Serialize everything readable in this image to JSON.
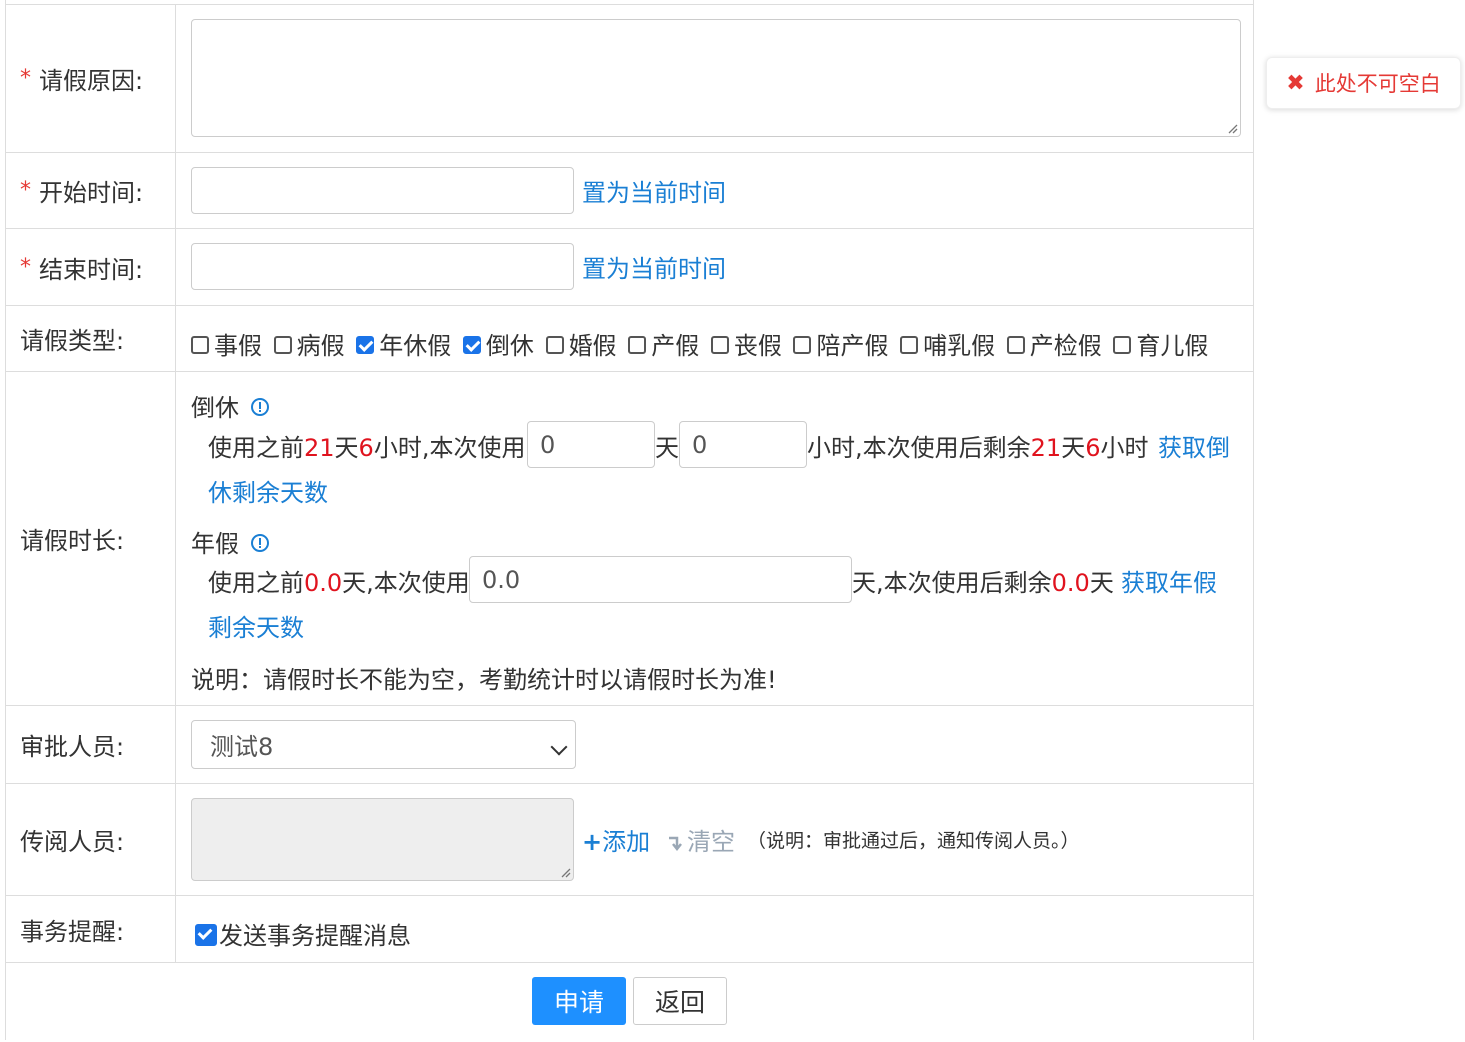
{
  "form": {
    "reason": {
      "label": "请假原因:",
      "required_mark": "*",
      "value": ""
    },
    "start_time": {
      "label": "开始时间:",
      "required_mark": "*",
      "value": "",
      "set_now_link": "置为当前时间"
    },
    "end_time": {
      "label": "结束时间:",
      "required_mark": "*",
      "value": "",
      "set_now_link": "置为当前时间"
    },
    "leave_type": {
      "label": "请假类型:",
      "options": [
        {
          "label": "事假",
          "checked": false
        },
        {
          "label": "病假",
          "checked": false
        },
        {
          "label": "年休假",
          "checked": true
        },
        {
          "label": "倒休",
          "checked": true
        },
        {
          "label": "婚假",
          "checked": false
        },
        {
          "label": "产假",
          "checked": false
        },
        {
          "label": "丧假",
          "checked": false
        },
        {
          "label": "陪产假",
          "checked": false
        },
        {
          "label": "哺乳假",
          "checked": false
        },
        {
          "label": "产检假",
          "checked": false
        },
        {
          "label": "育儿假",
          "checked": false
        }
      ]
    },
    "duration": {
      "label": "请假时长:",
      "comp": {
        "title": "倒休",
        "before_prefix": "使用之前",
        "before_days": "21",
        "day_unit": "天",
        "before_hours": "6",
        "hour_use_text": "小时,本次使用",
        "days_value": "0",
        "hours_value": "0",
        "after_text": "小时,本次使用后剩余",
        "after_days": "21",
        "after_hours": "6",
        "hour_unit": "小时",
        "link_line1": "获取倒",
        "link_line2": "休剩余天数"
      },
      "annual": {
        "title": "年假",
        "before_prefix": "使用之前",
        "before_days": "0.0",
        "use_text": "天,本次使用",
        "days_value": "0.0",
        "after_text": "天,本次使用后剩余",
        "after_days": "0.0",
        "day_unit": "天",
        "link_line1": "获取年假",
        "link_line2": "剩余天数"
      },
      "note": "说明：请假时长不能为空，考勤统计时以请假时长为准!"
    },
    "approver": {
      "label": "审批人员:",
      "selected": "测试8"
    },
    "cc": {
      "label": "传阅人员:",
      "add_label": "添加",
      "clear_label": "清空",
      "note": "（说明：审批通过后，通知传阅人员。）"
    },
    "reminder": {
      "label": "事务提醒:",
      "checkbox_label": "发送事务提醒消息",
      "checked": true
    },
    "actions": {
      "submit": "申请",
      "back": "返回"
    }
  },
  "validation_tip": {
    "message": "此处不可空白",
    "icon": "close-icon"
  },
  "colors": {
    "accent": "#1a7fd4",
    "primary_button": "#1e90ff",
    "error": "#e53935",
    "highlight": "#e0131e"
  }
}
